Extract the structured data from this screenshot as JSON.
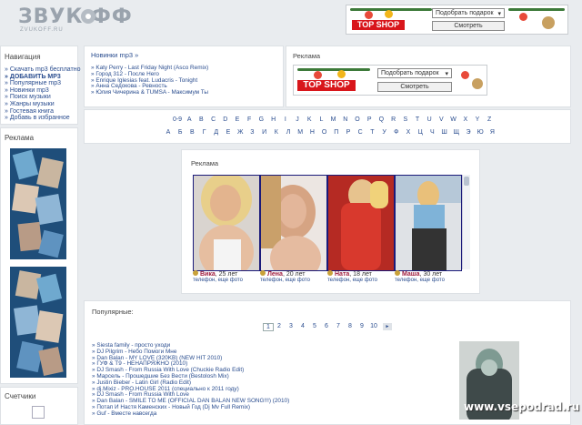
{
  "header": {
    "logo_text": "ЗВУК ФФ",
    "logo_sub": "ZVUKOFF.RU"
  },
  "ad_banner": {
    "brand": "TOP SHOP",
    "select_value": "Подобрать подарок",
    "button_label": "Смотреть"
  },
  "sidebar": {
    "nav_title": "Навигация",
    "nav_items": [
      "» Скачать mp3 бесплатно",
      "» ДОБАВИТЬ MP3",
      "» Популярные mp3",
      "» Новинки mp3",
      "» Поиск музыки",
      "» Жанры музыки",
      "» Гостевая книга",
      "» Добавь в избранное"
    ],
    "ads_title": "Реклама",
    "counters_title": "Счетчики"
  },
  "news": {
    "title": "Новинки mp3 »",
    "items": [
      "» Katy Perry - Last Friday Night (Asco Remix)",
      "» Город 312 - После Hero",
      "» Enrique Iglesias feat. Ludacris - Tonight",
      "» Анна Седокова - Ревность",
      "» Юлия Чичерина & TUMSA - Максимум Ты"
    ]
  },
  "ad_box": {
    "title": "Реклама"
  },
  "alphabet": {
    "latin": [
      "0-9",
      "A",
      "B",
      "C",
      "D",
      "E",
      "F",
      "G",
      "H",
      "I",
      "J",
      "K",
      "L",
      "M",
      "N",
      "O",
      "P",
      "Q",
      "R",
      "S",
      "T",
      "U",
      "V",
      "W",
      "X",
      "Y",
      "Z"
    ],
    "cyrillic": [
      "А",
      "Б",
      "В",
      "Г",
      "Д",
      "Е",
      "Ж",
      "З",
      "И",
      "К",
      "Л",
      "М",
      "Н",
      "О",
      "П",
      "Р",
      "С",
      "Т",
      "У",
      "Ф",
      "Х",
      "Ц",
      "Ч",
      "Ш",
      "Щ",
      "Э",
      "Ю",
      "Я"
    ]
  },
  "dating_ad": {
    "title": "Реклама",
    "profiles": [
      {
        "name": "Вика",
        "age": "25 лет",
        "links": "телефон, еще фото"
      },
      {
        "name": "Лена",
        "age": "20 лет",
        "links": "телефон, еще фото"
      },
      {
        "name": "Ната",
        "age": "18 лет",
        "links": "телефон, еще фото"
      },
      {
        "name": "Маша",
        "age": "30 лет",
        "links": "телефон, еще фото"
      }
    ]
  },
  "popular": {
    "title": "Популярные:",
    "pages": [
      "1",
      "2",
      "3",
      "4",
      "5",
      "6",
      "7",
      "8",
      "9",
      "10"
    ],
    "next_symbol": "►",
    "tracks": [
      "» Siesta family - просто уходи",
      "» DJ Pilgrim - Небо Помоги Мне",
      "» Dan Balan - MY LOVE (320KB) (NEW HIT 2010)",
      "» ГУФ & Т9 - НЕНАПРЯЖНО (2010)",
      "» DJ Smash - From Russia With Love (Chuckie Radio Edit)",
      "» Марсель - Прошедшие Без Вести (Bestolosh Mix)",
      "» Justin Bieber - Latin Girl (Radio Edit)",
      "» dj.Mixiz - PRO.HOUSE 2011 (специально к 2011 году)",
      "» DJ Smash - From Russia With Love",
      "» Dan Balan - SMILE TO ME (OFFICIAL DAN BALAN NEW SONG!!!) (2010)",
      "» Потап И Настя Каменских - Новый Год (Dj Mv Full Remix)",
      "» Guf - Вместе навсегда"
    ]
  },
  "watermark": "www.vsepodrad.ru"
}
